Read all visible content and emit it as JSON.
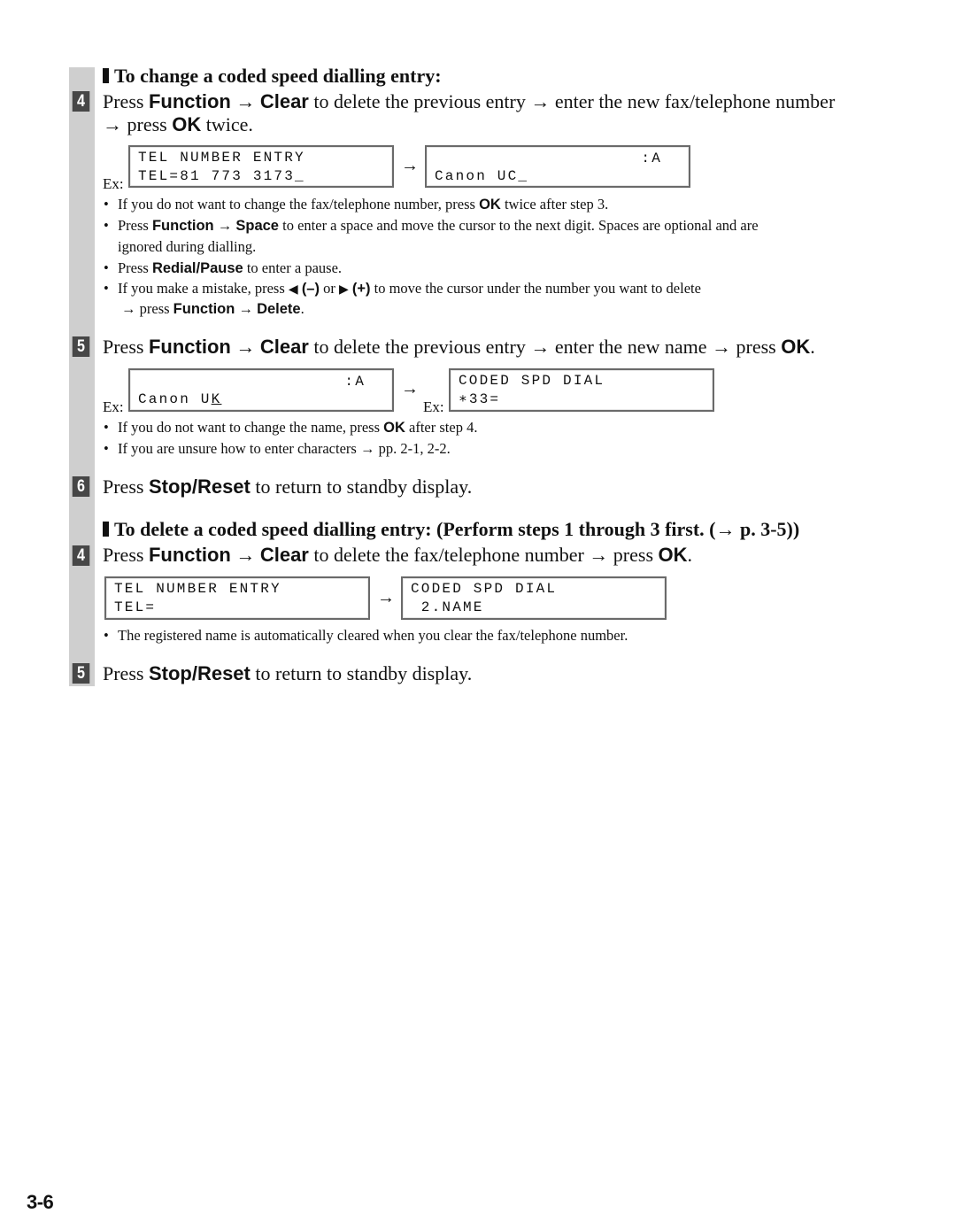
{
  "section_change": {
    "heading": "To change a coded speed dialling entry:",
    "step4": {
      "number": "4",
      "line1_a": "Press ",
      "key1": "Function",
      "arrow1": " → ",
      "key2": "Clear",
      "line1_b": " to delete the previous entry → enter the new fax/telephone number",
      "line2_a": "→ press ",
      "key3": "OK",
      "line2_b": " twice.",
      "example_label": "Ex:",
      "arrow": "→",
      "lcd_left": {
        "line1": "TEL NUMBER ENTRY",
        "line2": "TEL=81 773 3173_"
      },
      "lcd_right": {
        "line1": "",
        "indicator": ":A",
        "line2": "Canon UC_"
      },
      "notes": [
        {
          "pre": "If you do not want to change the fax/telephone number, press ",
          "key": "OK",
          "post": " twice after step 3."
        },
        {
          "pre": "Press ",
          "key": "Function",
          "mid": " → ",
          "key2": "Space",
          "post": " to enter a space and move the cursor to the next digit. Spaces are optional and are",
          "cont": "ignored during dialling."
        },
        {
          "pre": "Press ",
          "key": "Redial/Pause",
          "post": " to enter a pause."
        },
        {
          "pre": "If you make a mistake, press ",
          "left_icon": "◀",
          "key": "(–)",
          "mid": " or ",
          "right_icon": "▶",
          "key2": "(+)",
          "post": " to move the cursor under the number you want to delete",
          "cont_pre": "→ press ",
          "cont_key": "Function",
          "cont_mid": " → ",
          "cont_key2": "Delete",
          "cont_post": "."
        }
      ]
    },
    "step5": {
      "number": "5",
      "pre": "Press ",
      "key1": "Function",
      "arrow1": " → ",
      "key2": "Clear",
      "mid": " to delete the previous entry → enter the new name → press ",
      "key3": "OK",
      "post": ".",
      "example_label": "Ex:",
      "arrow": "→",
      "lcd_left": {
        "indicator": ":A",
        "line2_a": "Canon U",
        "line2_cursor": "K"
      },
      "lcd_right": {
        "line1": "CODED SPD DIAL",
        "line2": "∗33="
      },
      "notes": [
        {
          "pre": "If you do not want to change the name, press ",
          "key": "OK",
          "post": " after step 4."
        },
        {
          "pre": "If you are unsure how to enter characters → pp. 2-1, 2-2."
        }
      ]
    },
    "step6": {
      "number": "6",
      "pre": "Press ",
      "key": "Stop/Reset",
      "post": " to return to standby display."
    }
  },
  "section_delete": {
    "heading": "To delete a coded speed dialling entry: (Perform steps 1 through 3 first. (→ p. 3-5))",
    "step4": {
      "number": "4",
      "pre": "Press ",
      "key1": "Function",
      "arrow1": " → ",
      "key2": "Clear",
      "mid": " to delete the fax/telephone number → press ",
      "key3": "OK",
      "post": ".",
      "arrow": "→",
      "lcd_left": {
        "line1": "TEL NUMBER ENTRY",
        "line2": "TEL="
      },
      "lcd_right": {
        "line1": "CODED SPD DIAL",
        "line2": " 2.NAME"
      },
      "notes": [
        {
          "pre": "The registered name is automatically cleared when you clear the fax/telephone number."
        }
      ]
    },
    "step5": {
      "number": "5",
      "pre": "Press ",
      "key": "Stop/Reset",
      "post": " to return to standby display."
    }
  },
  "page_number": "3-6",
  "bullet": "•"
}
